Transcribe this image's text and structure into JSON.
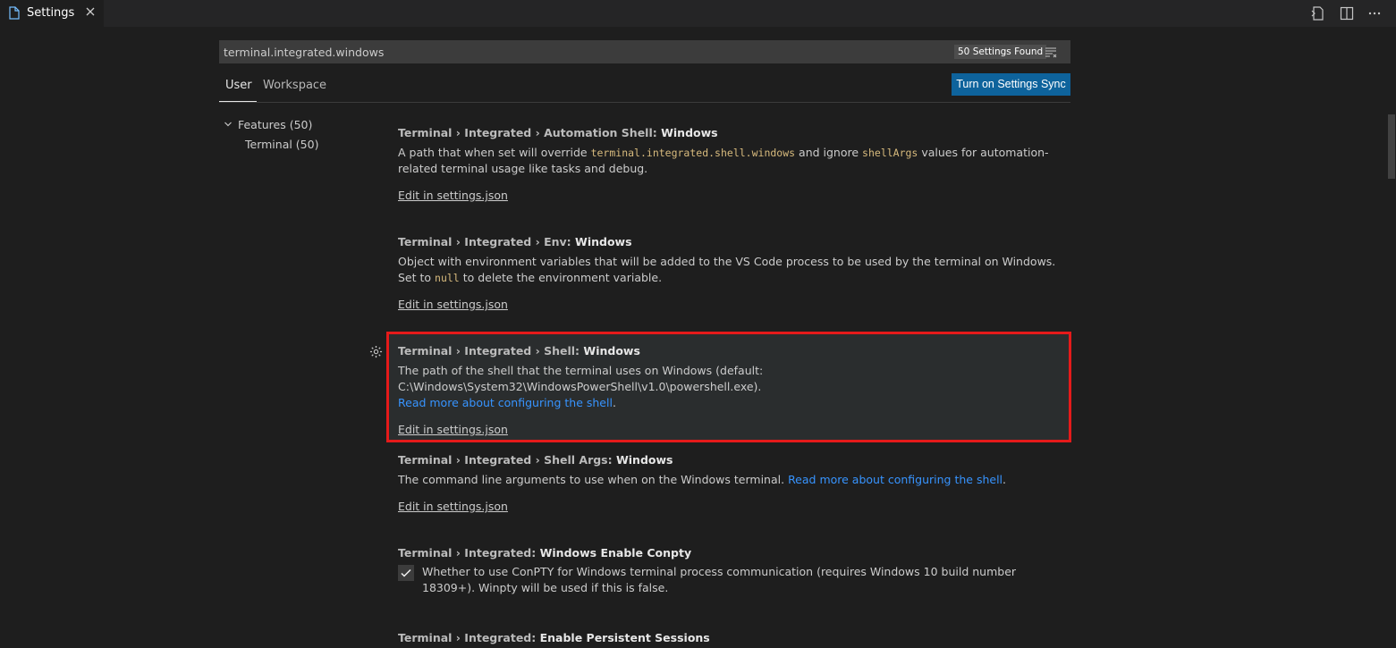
{
  "tab": {
    "label": "Settings"
  },
  "toolbar": {
    "open_json": "open-settings-json-icon",
    "split": "split-editor-icon",
    "more": "more-actions-icon"
  },
  "search": {
    "query": "terminal.integrated.windows",
    "found": "50 Settings Found"
  },
  "scope": {
    "user": "User",
    "workspace": "Workspace"
  },
  "sync_button": "Turn on Settings Sync",
  "toc": {
    "features": "Features (50)",
    "terminal": "Terminal (50)"
  },
  "settings": [
    {
      "prefix": "Terminal › Integrated › Automation Shell: ",
      "leaf": "Windows",
      "desc_a": "A path that when set will override ",
      "code_a": "terminal.integrated.shell.windows",
      "desc_b": " and ignore ",
      "code_b": "shellArgs",
      "desc_c": " values for automation-related terminal usage like tasks and debug.",
      "edit": "Edit in settings.json"
    },
    {
      "prefix": "Terminal › Integrated › Env: ",
      "leaf": "Windows",
      "desc_a": "Object with environment variables that will be added to the VS Code process to be used by the terminal on Windows. Set to ",
      "code_a": "null",
      "desc_b": " to delete the environment variable.",
      "edit": "Edit in settings.json"
    },
    {
      "prefix": "Terminal › Integrated › Shell: ",
      "leaf": "Windows",
      "desc_a": "The path of the shell that the terminal uses on Windows (default: C:\\Windows\\System32\\WindowsPowerShell\\v1.0\\powershell.exe). ",
      "link": "Read more about configuring the shell",
      "desc_b": ".",
      "edit": "Edit in settings.json"
    },
    {
      "prefix": "Terminal › Integrated › Shell Args: ",
      "leaf": "Windows",
      "desc_a": "The command line arguments to use when on the Windows terminal. ",
      "link": "Read more about configuring the shell",
      "desc_b": ".",
      "edit": "Edit in settings.json"
    },
    {
      "prefix": "Terminal › Integrated: ",
      "leaf": "Windows Enable Conpty",
      "desc_a": "Whether to use ConPTY for Windows terminal process communication (requires Windows 10 build number 18309+). Winpty will be used if this is false.",
      "checked": true
    },
    {
      "prefix": "Terminal › Integrated: ",
      "leaf": "Enable Persistent Sessions"
    }
  ],
  "colors": {
    "accent": "#0e639c",
    "link": "#3794ff",
    "code": "#d7ba7d",
    "highlight_border": "#e51a1a"
  }
}
